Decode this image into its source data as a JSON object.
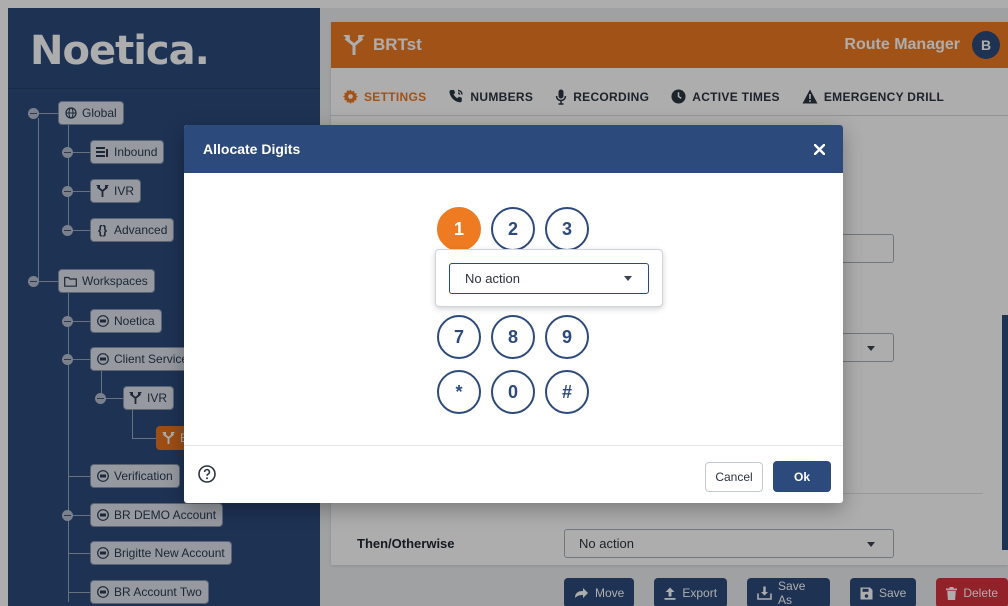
{
  "sidebar": {
    "brand": "Noetica.",
    "tree": {
      "global": {
        "label": "Global"
      },
      "inbound": {
        "label": "Inbound"
      },
      "ivr_top": {
        "label": "IVR"
      },
      "advanced": {
        "label": "Advanced"
      },
      "workspaces": {
        "label": "Workspaces"
      },
      "noetica": {
        "label": "Noetica"
      },
      "client_services": {
        "label": "Client Services"
      },
      "ivr_child": {
        "label": "IVR"
      },
      "brtst_child": {
        "label": "B"
      },
      "verification": {
        "label": "Verification"
      },
      "br_demo": {
        "label": "BR DEMO Account"
      },
      "brigitte": {
        "label": "Brigitte New Account"
      },
      "br_two": {
        "label": "BR Account Two"
      }
    }
  },
  "header": {
    "title": "BRTst",
    "app_name": "Route Manager",
    "avatar_letter": "B"
  },
  "tabs": [
    {
      "label": "SETTINGS",
      "icon": "gear-icon",
      "active": true
    },
    {
      "label": "NUMBERS",
      "icon": "phone-icon",
      "active": false
    },
    {
      "label": "RECORDING",
      "icon": "microphone-icon",
      "active": false
    },
    {
      "label": "ACTIVE TIMES",
      "icon": "clock-icon",
      "active": false
    },
    {
      "label": "EMERGENCY DRILL",
      "icon": "warning-icon",
      "active": false
    }
  ],
  "form": {
    "then_otherwise_label": "Then/Otherwise",
    "then_otherwise_value": "No action"
  },
  "footer_buttons": {
    "move": "Move",
    "export": "Export",
    "save_as": "Save As",
    "save": "Save",
    "delete": "Delete"
  },
  "modal": {
    "title": "Allocate Digits",
    "keys": [
      "1",
      "2",
      "3",
      "7",
      "8",
      "9",
      "*",
      "0",
      "#"
    ],
    "selected_key": "1",
    "action_value": "No action",
    "cancel_label": "Cancel",
    "ok_label": "Ok"
  },
  "colors": {
    "brand_navy": "#2d4a7c",
    "accent_orange": "#ee7a22",
    "danger_red": "#d8333e"
  }
}
